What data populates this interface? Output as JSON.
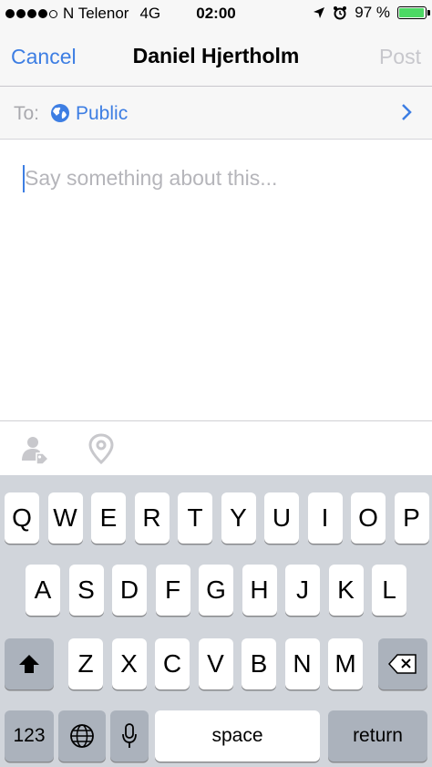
{
  "status_bar": {
    "carrier": "N Telenor",
    "network": "4G",
    "time": "02:00",
    "battery_text": "97 %",
    "battery_level": 0.97,
    "signal_bars": 4,
    "battery_color": "#4cd964"
  },
  "nav": {
    "cancel_label": "Cancel",
    "title": "Daniel Hjertholm",
    "post_label": "Post"
  },
  "audience": {
    "label": "To:",
    "value": "Public",
    "icon": "globe-icon"
  },
  "compose": {
    "placeholder": "Say something about this..."
  },
  "attachments": {
    "tag_icon": "tag-people-icon",
    "location_icon": "location-pin-icon"
  },
  "keyboard": {
    "row1": [
      "Q",
      "W",
      "E",
      "R",
      "T",
      "Y",
      "U",
      "I",
      "O",
      "P"
    ],
    "row2": [
      "A",
      "S",
      "D",
      "F",
      "G",
      "H",
      "J",
      "K",
      "L"
    ],
    "row3": [
      "Z",
      "X",
      "C",
      "V",
      "B",
      "N",
      "M"
    ],
    "numbers_label": "123",
    "space_label": "space",
    "return_label": "return"
  },
  "colors": {
    "accent": "#3d7ee3",
    "disabled": "#c7c7cc",
    "keyboard_bg": "#d1d5db",
    "special_key": "#abb2bc"
  }
}
